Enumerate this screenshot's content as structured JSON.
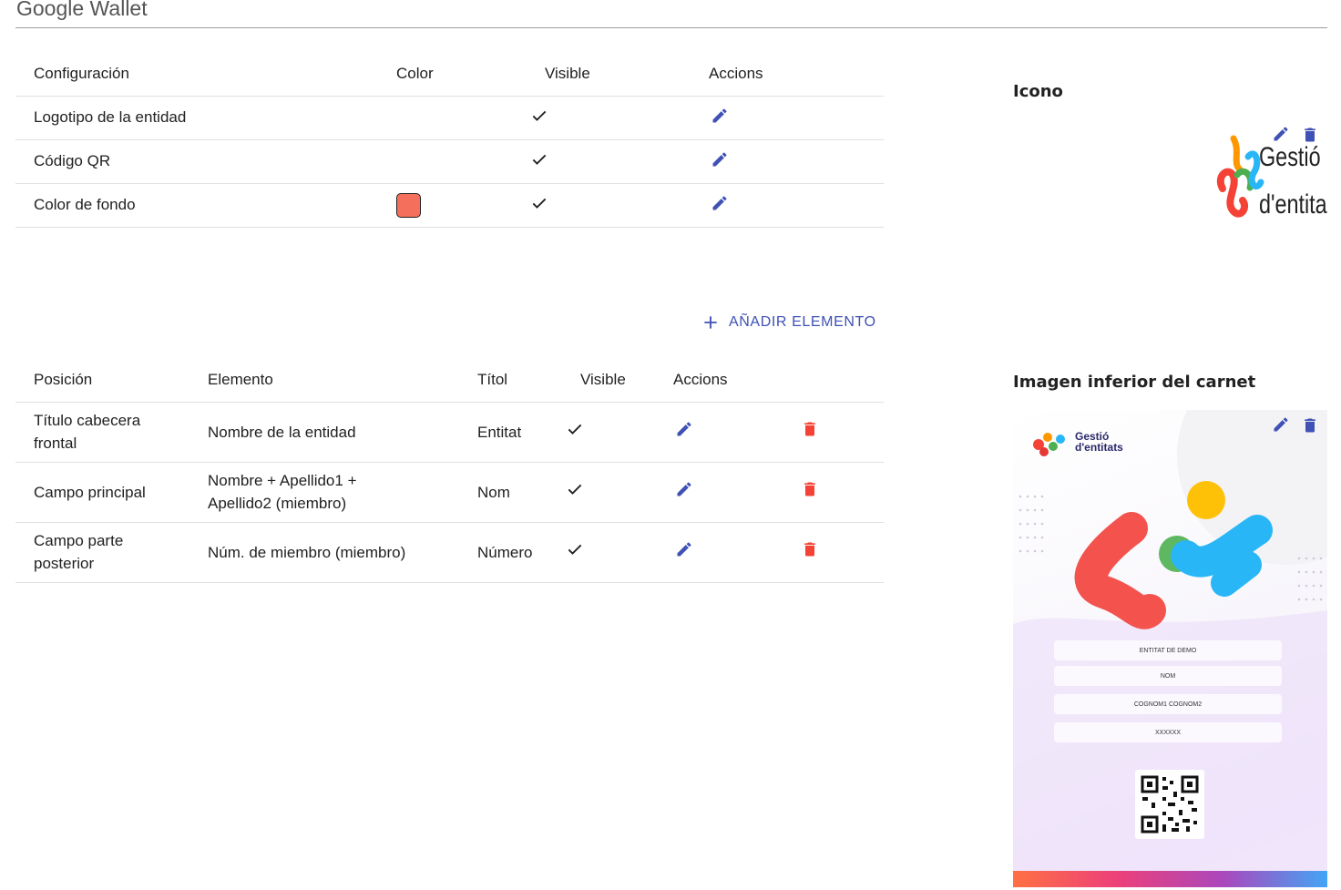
{
  "page": {
    "title": "Google Wallet"
  },
  "config_table": {
    "headers": [
      "Configuración",
      "Color",
      "Visible",
      "Accions"
    ],
    "rows": [
      {
        "name": "Logotipo de la entidad",
        "visible": true
      },
      {
        "name": "Código QR",
        "visible": true
      },
      {
        "name": "Color de fondo",
        "color": "#f4705c",
        "visible": true
      }
    ]
  },
  "add_element": {
    "label": "AÑADIR ELEMENTO"
  },
  "position_table": {
    "headers": [
      "Posición",
      "Elemento",
      "Títol",
      "Visible",
      "Accions"
    ],
    "rows": [
      {
        "position": "Título cabecera frontal",
        "element": "Nombre de la entidad",
        "title": "Entitat",
        "visible": true
      },
      {
        "position": "Campo principal",
        "element": "Nombre + Apellido1 + Apellido2 (miembro)",
        "title": "Nom",
        "visible": true
      },
      {
        "position": "Campo parte posterior",
        "element": "Núm. de miembro (miembro)",
        "title": "Número",
        "visible": true
      }
    ]
  },
  "sidebar": {
    "icon_heading": "Icono",
    "logo_text_line1": "Gestió",
    "logo_text_line2": "d'entitats",
    "image_heading": "Imagen inferior del carnet",
    "card": {
      "brand_line1": "Gestió",
      "brand_line2": "d'entitats",
      "fields": [
        "ENTITAT DE DEMO",
        "NOM",
        "COGNOM1 COGNOM2",
        "XXXXXX"
      ]
    }
  },
  "colors": {
    "accent": "#3f51b5",
    "delete": "#f44336",
    "swatch": "#f4705c"
  },
  "icons": {
    "edit": "pencil-icon",
    "delete": "trash-icon",
    "visible": "check-icon",
    "add": "plus-icon"
  }
}
